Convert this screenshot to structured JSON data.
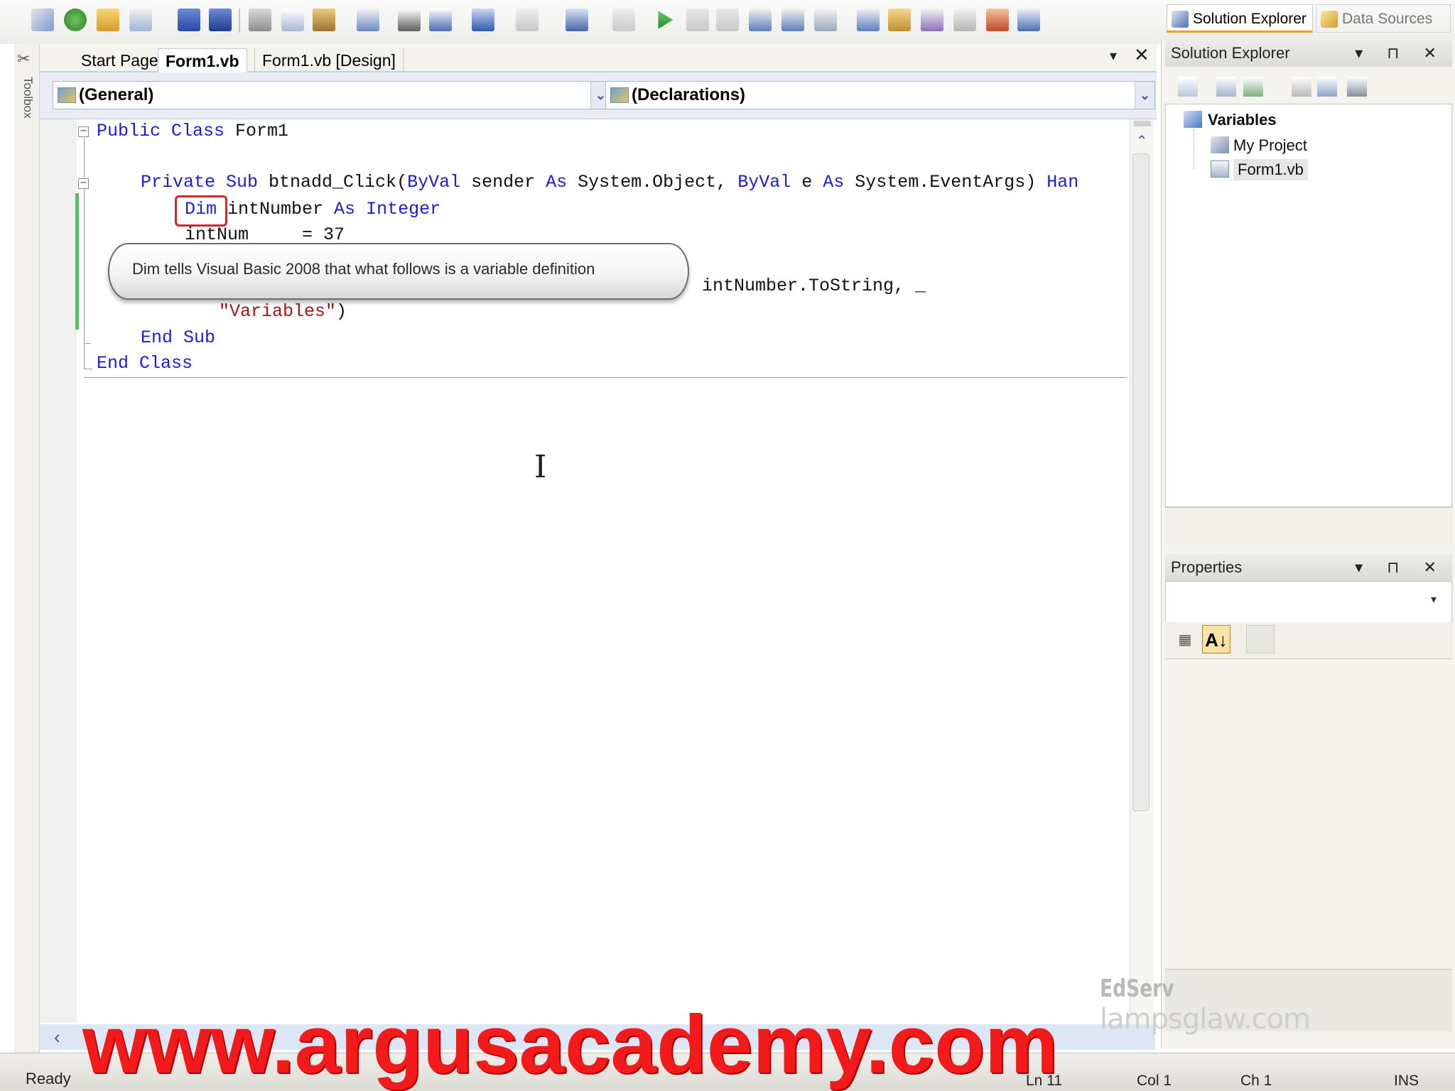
{
  "editor_tabs": {
    "start_page": "Start Page",
    "form1_vb": "Form1.vb",
    "form1_design": "Form1.vb [Design]",
    "dropdown_glyph": "▾",
    "close_glyph": "✕"
  },
  "toolbox": {
    "label": "Toolbox"
  },
  "combos": {
    "general": "(General)",
    "declarations": "(Declarations)"
  },
  "code": {
    "line1": {
      "kw1": "Public Class",
      "plain": " Form1"
    },
    "line3": {
      "kw1": "Private Sub",
      "p1": " btnadd_Click(",
      "kw2": "ByVal",
      "p2": " sender ",
      "kw3": "As",
      "p3": " System.Object, ",
      "kw4": "ByVal",
      "p4": " e ",
      "kw5": "As",
      "p5": " System.EventArgs) ",
      "kw6": "Han"
    },
    "line4": {
      "kw1": "Dim",
      "p1": " intNumber ",
      "kw2": "As",
      "kw3": "Integer"
    },
    "line5": {
      "plain": "intNum     = 37"
    },
    "line6": {
      "plain": "intNumber.ToString, _"
    },
    "line7": {
      "str": "\"Variables\"",
      "plain": ")"
    },
    "line8": {
      "kw1": "End Sub"
    },
    "line9": {
      "kw1": "End Class"
    }
  },
  "callout": {
    "text": "Dim tells Visual Basic 2008 that what follows is a variable definition"
  },
  "solution_explorer": {
    "title": "Solution Explorer",
    "buttons": "▾ ⊓ ✕",
    "tree": {
      "project": "Variables",
      "my_project": "My Project",
      "form1": "Form1.vb"
    },
    "tab_solution_explorer": "Solution Explorer",
    "tab_data_sources": "Data Sources"
  },
  "properties": {
    "title": "Properties",
    "buttons": "▾ ⊓ ✕",
    "alpha_glyph": "A↓"
  },
  "status": {
    "ready": "Ready",
    "ln": "Ln 11",
    "col": "Col 1",
    "ch": "Ch 1",
    "ins": "INS"
  },
  "watermarks": {
    "argus": "www.argusacademy.com",
    "edserv": "EdServ",
    "lamps": "lampsglaw.com"
  },
  "colors": {
    "keyword": "#1c1cd6",
    "string": "#a31515",
    "highlight_box": "#d22a2a",
    "argus_watermark": "#f21a1a",
    "change_bar": "#57c05a"
  }
}
